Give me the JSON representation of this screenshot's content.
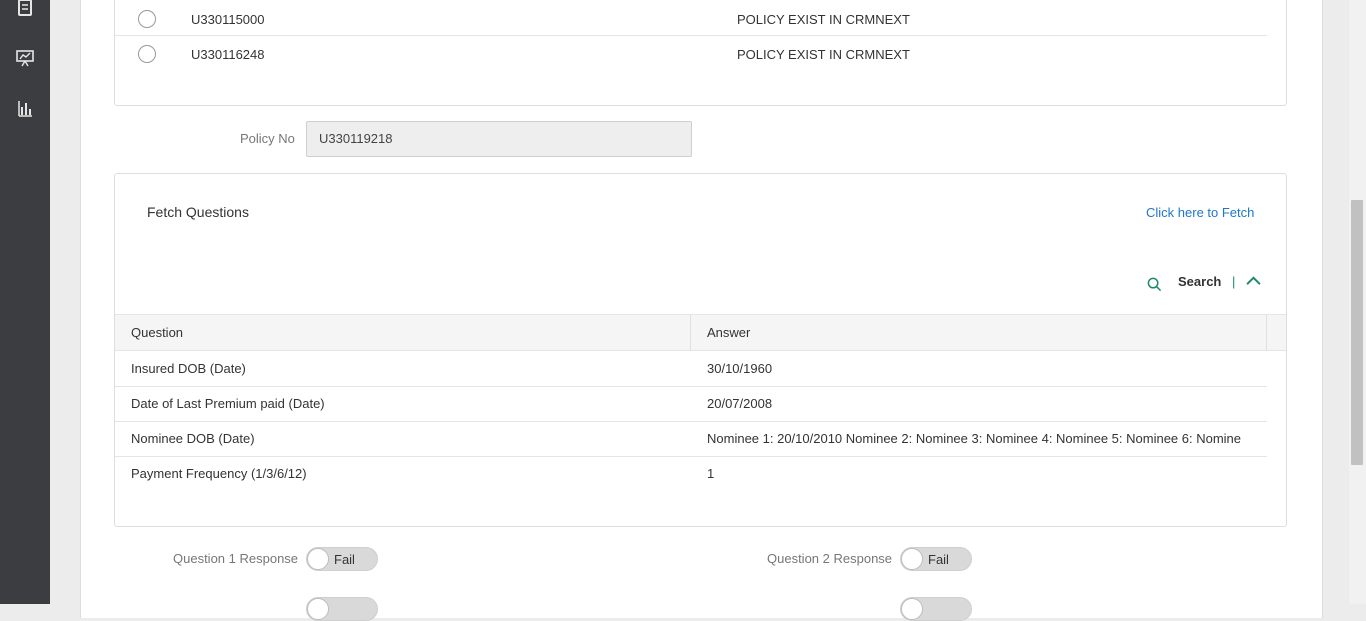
{
  "sidebar": {
    "icons": [
      "receipt-icon",
      "presentation-icon",
      "bar-chart-icon"
    ]
  },
  "policy_list": {
    "rows": [
      {
        "policy": "U330115000",
        "status": "POLICY EXIST IN CRMNEXT"
      },
      {
        "policy": "U330116248",
        "status": "POLICY EXIST IN CRMNEXT"
      }
    ]
  },
  "policy_no": {
    "label": "Policy No",
    "value": "U330119218"
  },
  "fetch": {
    "title": "Fetch Questions",
    "link": "Click here to Fetch",
    "search_label": "Search",
    "separator": "|"
  },
  "table": {
    "headers": [
      "Question",
      "Answer"
    ],
    "rows": [
      {
        "question": "Insured DOB (Date)",
        "answer": "30/10/1960"
      },
      {
        "question": "Date of Last Premium paid (Date)",
        "answer": "20/07/2008"
      },
      {
        "question": "Nominee DOB (Date)",
        "answer": "Nominee 1: 20/10/2010 Nominee 2: Nominee 3: Nominee 4: Nominee 5: Nominee 6: Nomine..."
      },
      {
        "question": "Payment Frequency (1/3/6/12)",
        "answer": "1"
      }
    ]
  },
  "responses": [
    {
      "label": "Question 1 Response",
      "value": "Fail"
    },
    {
      "label": "Question 2 Response",
      "value": "Fail"
    }
  ],
  "colors": {
    "sidebar_bg": "#3c3d41",
    "accent_teal": "#1b8a6b",
    "link_blue": "#1f77c8"
  }
}
